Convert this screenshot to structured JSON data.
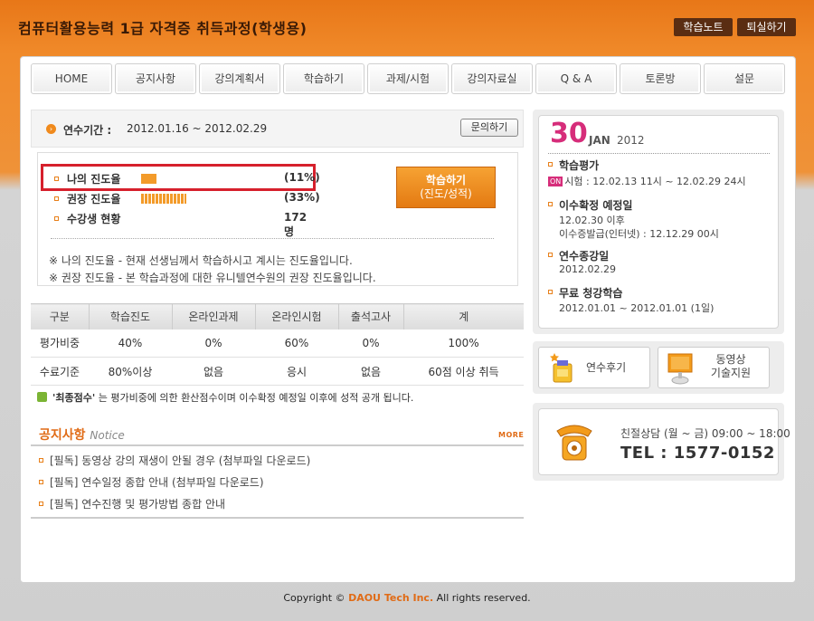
{
  "header": {
    "site_title": "컴퓨터활용능력 1급 자격증 취득과정(학생용)",
    "study_note_label": "학습노트",
    "logout_label": "퇴실하기"
  },
  "nav": {
    "items": [
      "HOME",
      "공지사항",
      "강의계획서",
      "학습하기",
      "과제/시험",
      "강의자료실",
      "Q & A",
      "토론방",
      "설문"
    ]
  },
  "period": {
    "label": "연수기간 :",
    "value": "2012.01.16 ~ 2012.02.29",
    "inquiry_label": "문의하기"
  },
  "progress": {
    "my": {
      "label": "나의 진도율",
      "value": "(11%)",
      "percent": 11
    },
    "recommended": {
      "label": "권장 진도율",
      "value": "(33%)",
      "percent": 33
    },
    "students": {
      "label": "수강생 현황",
      "value": "172명"
    },
    "note1": "※ 나의 진도율 - 현재 선생님께서 학습하시고 계시는 진도율입니다.",
    "note2": "※ 권장 진도율 - 본 학습과정에 대한 유니텔연수원의 권장 진도율입니다.",
    "study_button": {
      "line1": "학습하기",
      "line2": "(진도/성적)"
    }
  },
  "grade_table": {
    "headers": [
      "구분",
      "학습진도",
      "온라인과제",
      "온라인시험",
      "출석고사",
      "계"
    ],
    "rows": [
      [
        "평가비중",
        "40%",
        "0%",
        "60%",
        "0%",
        "100%"
      ],
      [
        "수료기준",
        "80%이상",
        "없음",
        "응시",
        "없음",
        "60점 이상 취득"
      ]
    ]
  },
  "final_note": {
    "bold": "'최종점수'",
    "text": "는 평가비중에 의한 환산점수이며 이수확정 예정일 이후에 성적 공개 됩니다."
  },
  "notice": {
    "title": "공지사항",
    "subtitle": "Notice",
    "more_label": "MORE",
    "items": [
      "[필독] 동영상 강의 재생이 안될 경우 (첨부파일 다운로드)",
      "[필독] 연수일정 종합 안내 (첨부파일 다운로드)",
      "[필독] 연수진행 및 평가방법 종합 안내"
    ]
  },
  "calendar": {
    "day": "30",
    "month": "JAN",
    "year": "2012",
    "schedule": [
      {
        "title": "학습평가",
        "badge": "ON",
        "lines": [
          "시험 : 12.02.13 11시 ~ 12.02.29 24시"
        ]
      },
      {
        "title": "이수확정 예정일",
        "lines": [
          "12.02.30 이후",
          "이수증발급(인터넷) : 12.12.29 00시"
        ]
      },
      {
        "title": "연수종강일",
        "lines": [
          "2012.02.29"
        ]
      },
      {
        "title": "무료 청강학습",
        "lines": [
          "2012.01.01 ~ 2012.01.01 (1일)"
        ]
      }
    ]
  },
  "quick_links": {
    "review_label": "연수후기",
    "video_support_line1": "동영상",
    "video_support_line2": "기술지원"
  },
  "contact": {
    "hours": "친절상담 (월 ~ 금) 09:00 ~ 18:00",
    "tel": "TEL : 1577-0152"
  },
  "footer": {
    "prefix": "Copyright ©",
    "brand": "DAOU Tech Inc.",
    "suffix": "All rights reserved."
  },
  "colors": {
    "accent_orange": "#e06b16",
    "highlight_red": "#d6202c",
    "date_pink": "#d62d7a"
  }
}
